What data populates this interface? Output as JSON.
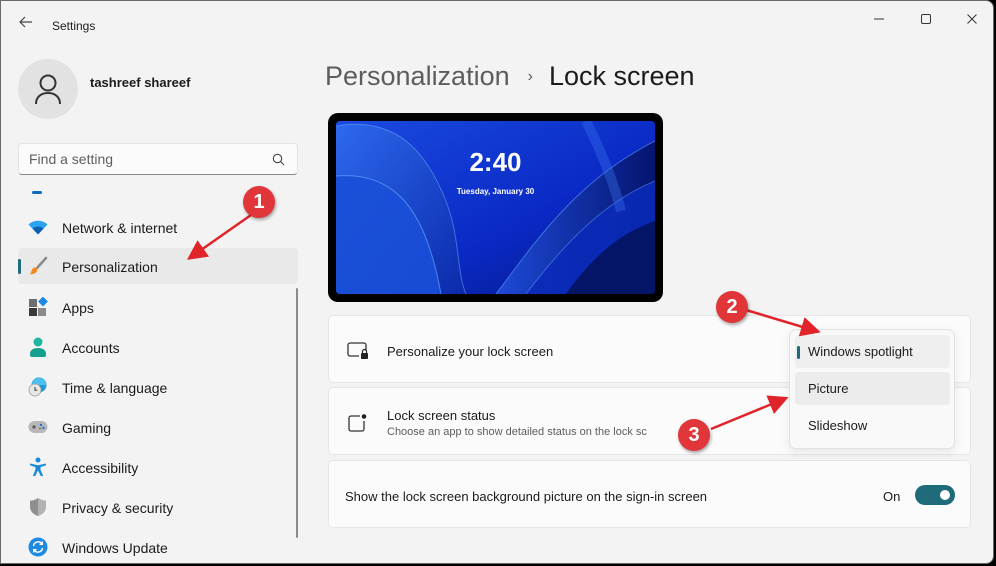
{
  "window": {
    "app_title": "Settings",
    "controls": {
      "minimize": "minimize-icon",
      "maximize": "maximize-icon",
      "close": "close-icon"
    }
  },
  "profile": {
    "name": "tashreef shareef"
  },
  "search": {
    "placeholder": "Find a setting",
    "value": ""
  },
  "sidebar": {
    "items": [
      {
        "label": "Network & internet",
        "icon": "wifi-icon",
        "active": false
      },
      {
        "label": "Personalization",
        "icon": "brush-icon",
        "active": true
      },
      {
        "label": "Apps",
        "icon": "apps-icon",
        "active": false
      },
      {
        "label": "Accounts",
        "icon": "account-icon",
        "active": false
      },
      {
        "label": "Time & language",
        "icon": "globe-clock-icon",
        "active": false
      },
      {
        "label": "Gaming",
        "icon": "gamepad-icon",
        "active": false
      },
      {
        "label": "Accessibility",
        "icon": "accessibility-icon",
        "active": false
      },
      {
        "label": "Privacy & security",
        "icon": "shield-icon",
        "active": false
      },
      {
        "label": "Windows Update",
        "icon": "update-icon",
        "active": false
      }
    ]
  },
  "breadcrumb": {
    "parent": "Personalization",
    "separator": "›",
    "current": "Lock screen"
  },
  "preview": {
    "time": "2:40",
    "date": "Tuesday, January 30"
  },
  "settings": {
    "personalize": {
      "title": "Personalize your lock screen"
    },
    "status": {
      "title": "Lock screen status",
      "subtitle": "Choose an app to show detailed status on the lock sc"
    },
    "signin": {
      "title": "Show the lock screen background picture on the sign-in screen",
      "state_label": "On",
      "enabled": true
    }
  },
  "dropdown": {
    "options": [
      "Windows spotlight",
      "Picture",
      "Slideshow"
    ],
    "selected": "Windows spotlight",
    "highlighted": "Picture"
  },
  "annotations": {
    "badges": [
      "1",
      "2",
      "3"
    ],
    "color": "#e0363a"
  },
  "colors": {
    "accent": "#1f6b7a",
    "background": "#f3f3f3",
    "card": "#fbfbfb"
  }
}
